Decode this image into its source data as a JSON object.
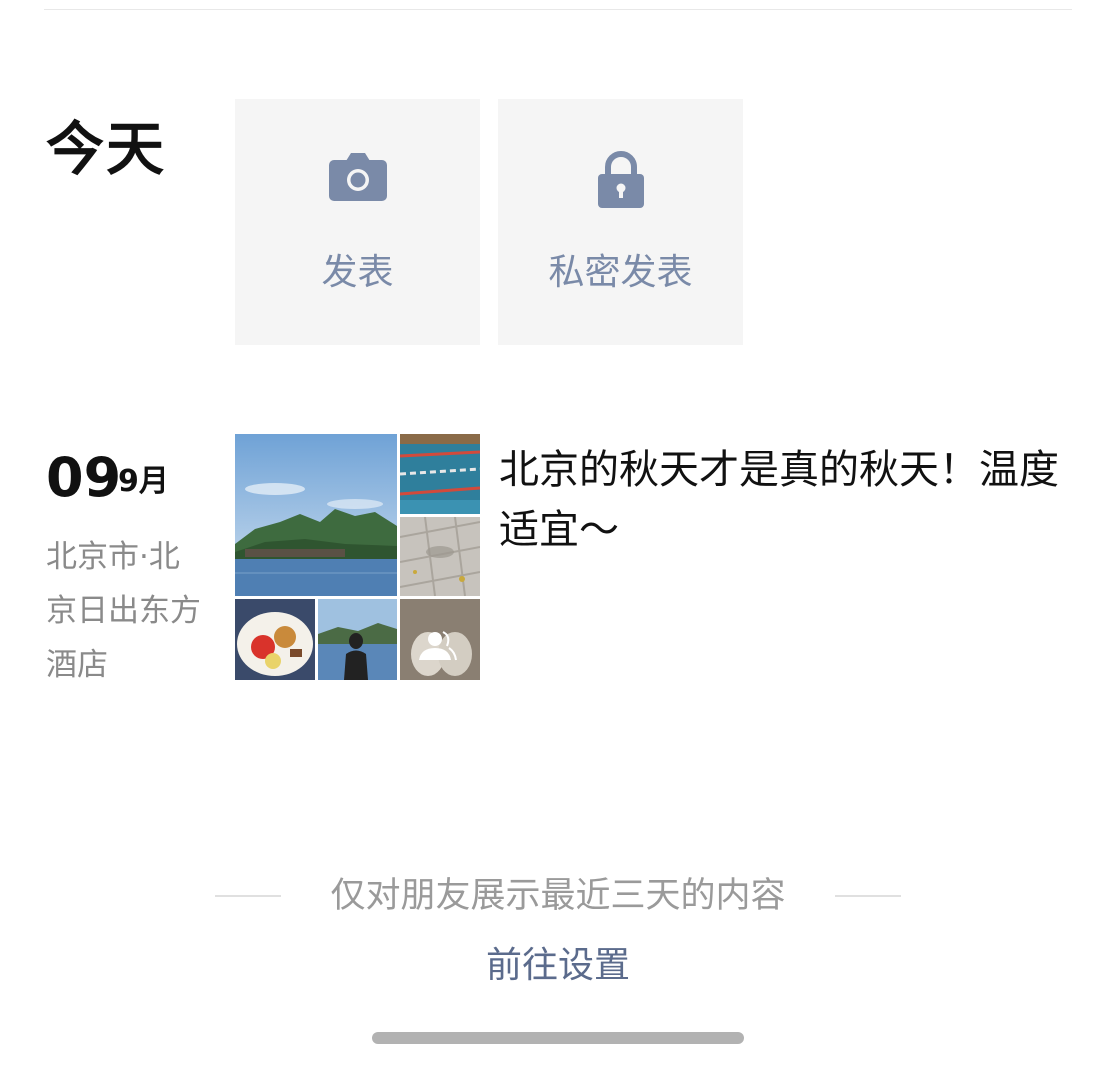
{
  "today": {
    "label": "今天"
  },
  "actions": [
    {
      "label": "发表",
      "icon": "camera-icon"
    },
    {
      "label": "私密发表",
      "icon": "lock-icon"
    }
  ],
  "post": {
    "day": "09",
    "month": "9月",
    "location": "北京市·北京日出东方酒店",
    "text": "北京的秋天才是真的秋天！温度适宜～",
    "photos": [
      "lake-mountain-photo",
      "swimming-pool-photo",
      "pavement-photo",
      "food-plate-photo",
      "person-by-lake-photo",
      "slippers-photo"
    ],
    "visibility_icon": "friends-visibility-icon"
  },
  "footer": {
    "note": "仅对朋友展示最近三天的内容",
    "link": "前往设置"
  },
  "colors": {
    "accent": "#7a8aa8",
    "link": "#5b6b8c",
    "tile_bg": "#f5f5f5",
    "muted": "#8a8a8a"
  }
}
